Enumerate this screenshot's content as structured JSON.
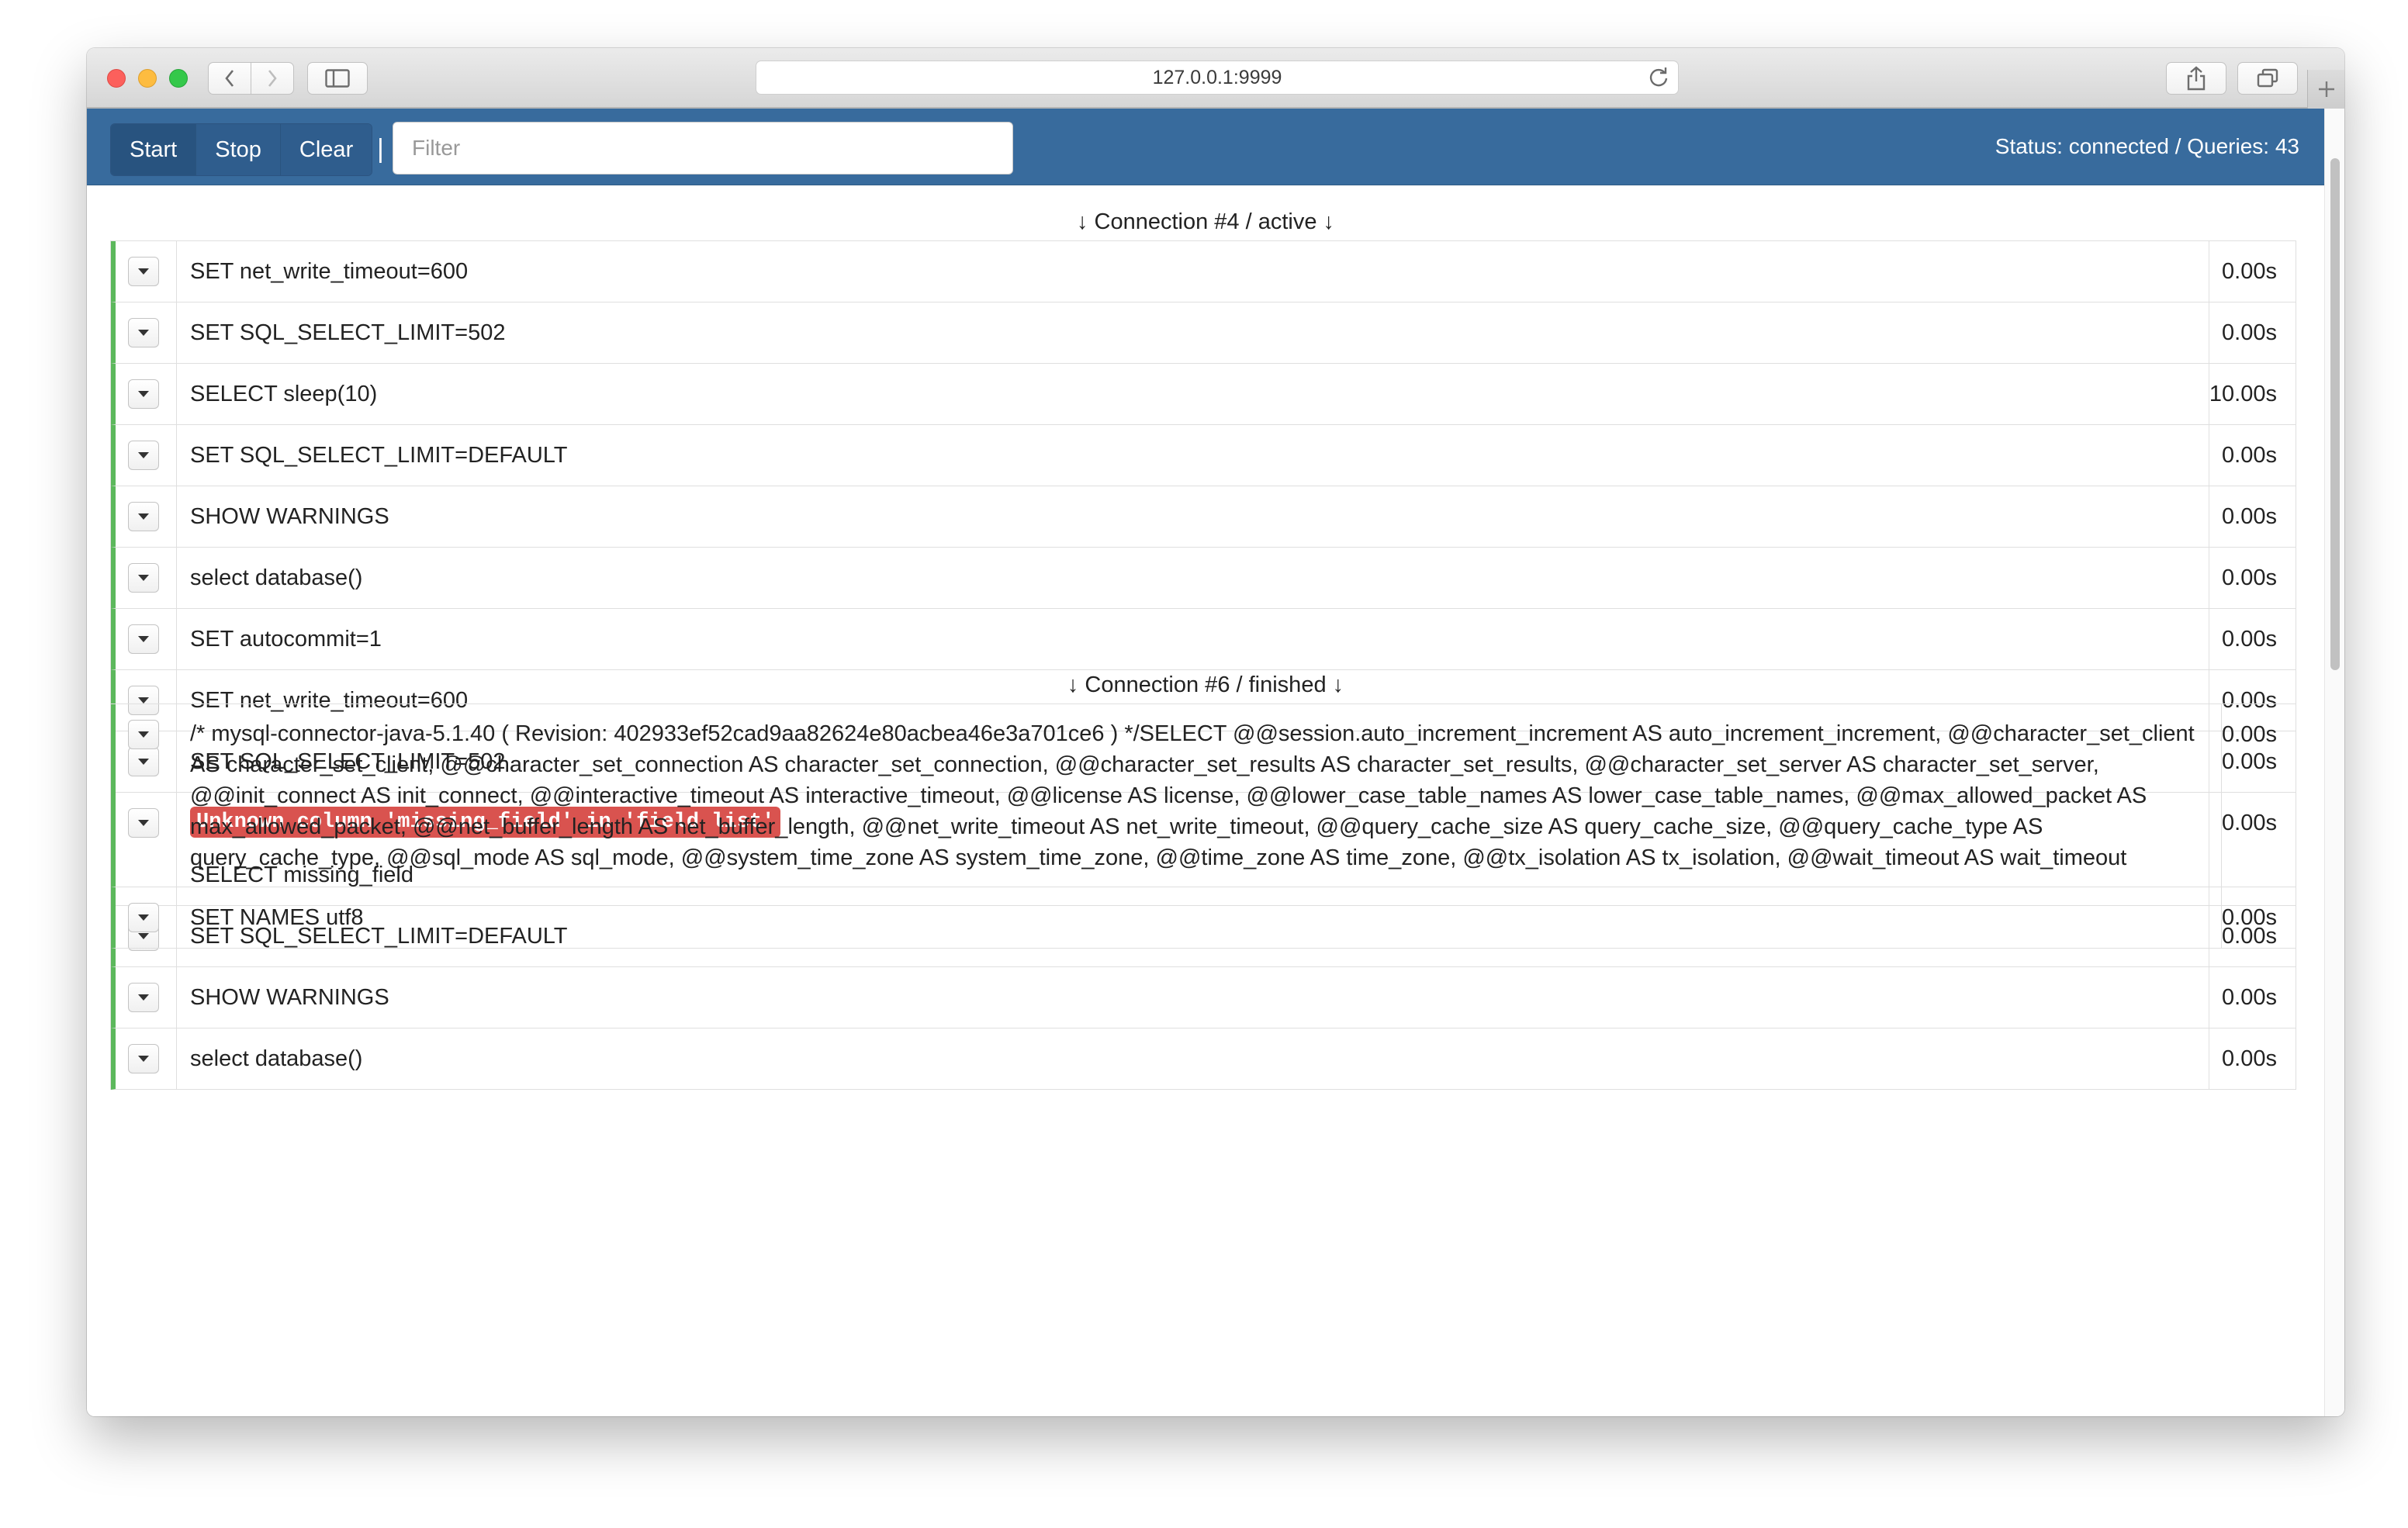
{
  "browser": {
    "url": "127.0.0.1:9999",
    "icons": [
      "back-icon",
      "forward-icon",
      "sidebar-icon",
      "reload-icon",
      "share-icon",
      "tabs-icon",
      "plus-icon"
    ]
  },
  "toolbar": {
    "start_label": "Start",
    "stop_label": "Stop",
    "clear_label": "Clear",
    "separator": "|",
    "filter_placeholder": "Filter",
    "filter_value": "",
    "status": "Status: connected / Queries: 43"
  },
  "colors": {
    "navbar": "#386b9d",
    "ok_marker": "#5cb85c",
    "error_marker": "#d9534f"
  },
  "connections": [
    {
      "heading": "↓ Connection #4 / active ↓",
      "queries": [
        {
          "sql": "SET net_write_timeout=600",
          "time": "0.00s",
          "status": "ok"
        },
        {
          "sql": "SET SQL_SELECT_LIMIT=502",
          "time": "0.00s",
          "status": "ok"
        },
        {
          "sql": "SELECT sleep(10)",
          "time": "10.00s",
          "status": "ok"
        },
        {
          "sql": "SET SQL_SELECT_LIMIT=DEFAULT",
          "time": "0.00s",
          "status": "ok"
        },
        {
          "sql": "SHOW WARNINGS",
          "time": "0.00s",
          "status": "ok"
        },
        {
          "sql": "select database()",
          "time": "0.00s",
          "status": "ok"
        },
        {
          "sql": "SET autocommit=1",
          "time": "0.00s",
          "status": "ok"
        },
        {
          "sql": "SET net_write_timeout=600",
          "time": "0.00s",
          "status": "ok"
        },
        {
          "sql": "SET SQL_SELECT_LIMIT=502",
          "time": "0.00s",
          "status": "ok"
        },
        {
          "sql": "SELECT missing_field",
          "time": "0.00s",
          "status": "error",
          "error": "Unknown column 'missing_field' in 'field list'"
        },
        {
          "sql": "SET SQL_SELECT_LIMIT=DEFAULT",
          "time": "0.00s",
          "status": "ok"
        },
        {
          "sql": "SHOW WARNINGS",
          "time": "0.00s",
          "status": "ok"
        },
        {
          "sql": "select database()",
          "time": "0.00s",
          "status": "ok"
        }
      ]
    },
    {
      "heading": "↓ Connection #6 / finished ↓",
      "queries": [
        {
          "sql": "/* mysql-connector-java-5.1.40 ( Revision: 402933ef52cad9aa82624e80acbea46e3a701ce6 ) */SELECT @@session.auto_increment_increment AS auto_increment_increment, @@character_set_client AS character_set_client, @@character_set_connection AS character_set_connection, @@character_set_results AS character_set_results, @@character_set_server AS character_set_server, @@init_connect AS init_connect, @@interactive_timeout AS interactive_timeout, @@license AS license, @@lower_case_table_names AS lower_case_table_names, @@max_allowed_packet AS max_allowed_packet, @@net_buffer_length AS net_buffer_length, @@net_write_timeout AS net_write_timeout, @@query_cache_size AS query_cache_size, @@query_cache_type AS query_cache_type, @@sql_mode AS sql_mode, @@system_time_zone AS system_time_zone, @@time_zone AS time_zone, @@tx_isolation AS tx_isolation, @@wait_timeout AS wait_timeout",
          "time": "0.00s",
          "status": "ok"
        },
        {
          "sql": "SET NAMES utf8",
          "time": "0.00s",
          "status": "ok"
        }
      ]
    }
  ]
}
